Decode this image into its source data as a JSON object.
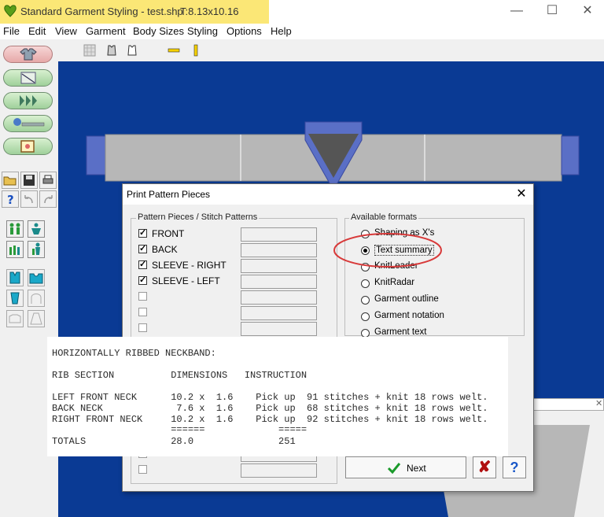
{
  "window": {
    "title": "Standard Garment Styling - test.shp",
    "dimensions": "T:8.13x10.16",
    "minimize_glyph": "—",
    "maximize_glyph": "☐",
    "close_glyph": "✕"
  },
  "menu": {
    "items": [
      "File",
      "Edit",
      "View",
      "Garment",
      "Body Sizes",
      "Styling",
      "Options",
      "Help"
    ]
  },
  "dialog": {
    "title": "Print Pattern Pieces",
    "close_glyph": "✕",
    "pieces_group_label": "Pattern Pieces / Stitch Patterns",
    "formats_group_label": "Available formats",
    "pieces": [
      {
        "label": "FRONT",
        "checked": true
      },
      {
        "label": "BACK",
        "checked": true
      },
      {
        "label": "SLEEVE - RIGHT",
        "checked": true
      },
      {
        "label": "SLEEVE - LEFT",
        "checked": true
      },
      {
        "label": "",
        "checked": false
      },
      {
        "label": "",
        "checked": false
      },
      {
        "label": "",
        "checked": false
      }
    ],
    "formats": [
      {
        "label": "Shaping as X's",
        "selected": false
      },
      {
        "label": "Text summary",
        "selected": true
      },
      {
        "label": "KnitLeader",
        "selected": false
      },
      {
        "label": "KnitRadar",
        "selected": false
      },
      {
        "label": "Garment outline",
        "selected": false
      },
      {
        "label": "Garment notation",
        "selected": false
      },
      {
        "label": "Garment text",
        "selected": false
      }
    ],
    "check_glyph": "✓",
    "next_label": "Next",
    "cancel_glyph": "✘",
    "help_glyph": "?"
  },
  "summary": {
    "heading": "HORIZONTALLY RIBBED NECKBAND:",
    "columns": "RIB SECTION          DIMENSIONS   INSTRUCTION",
    "rows": [
      "LEFT FRONT NECK      10.2 x  1.6    Pick up  91 stitches + knit 18 rows welt.",
      "BACK NECK             7.6 x  1.6    Pick up  68 stitches + knit 18 rows welt.",
      "RIGHT FRONT NECK     10.2 x  1.6    Pick up  92 stitches + knit 18 rows welt."
    ],
    "rule": "                     ======             =====",
    "totals": "TOTALS               28.0               251"
  },
  "colors": {
    "canvas": "#0a3a94",
    "title_highlight": "#fbe776",
    "annotation_ring": "#d83a3a",
    "garment_fill": "#b7b7b7",
    "garment_accent": "#5a6fc6"
  }
}
